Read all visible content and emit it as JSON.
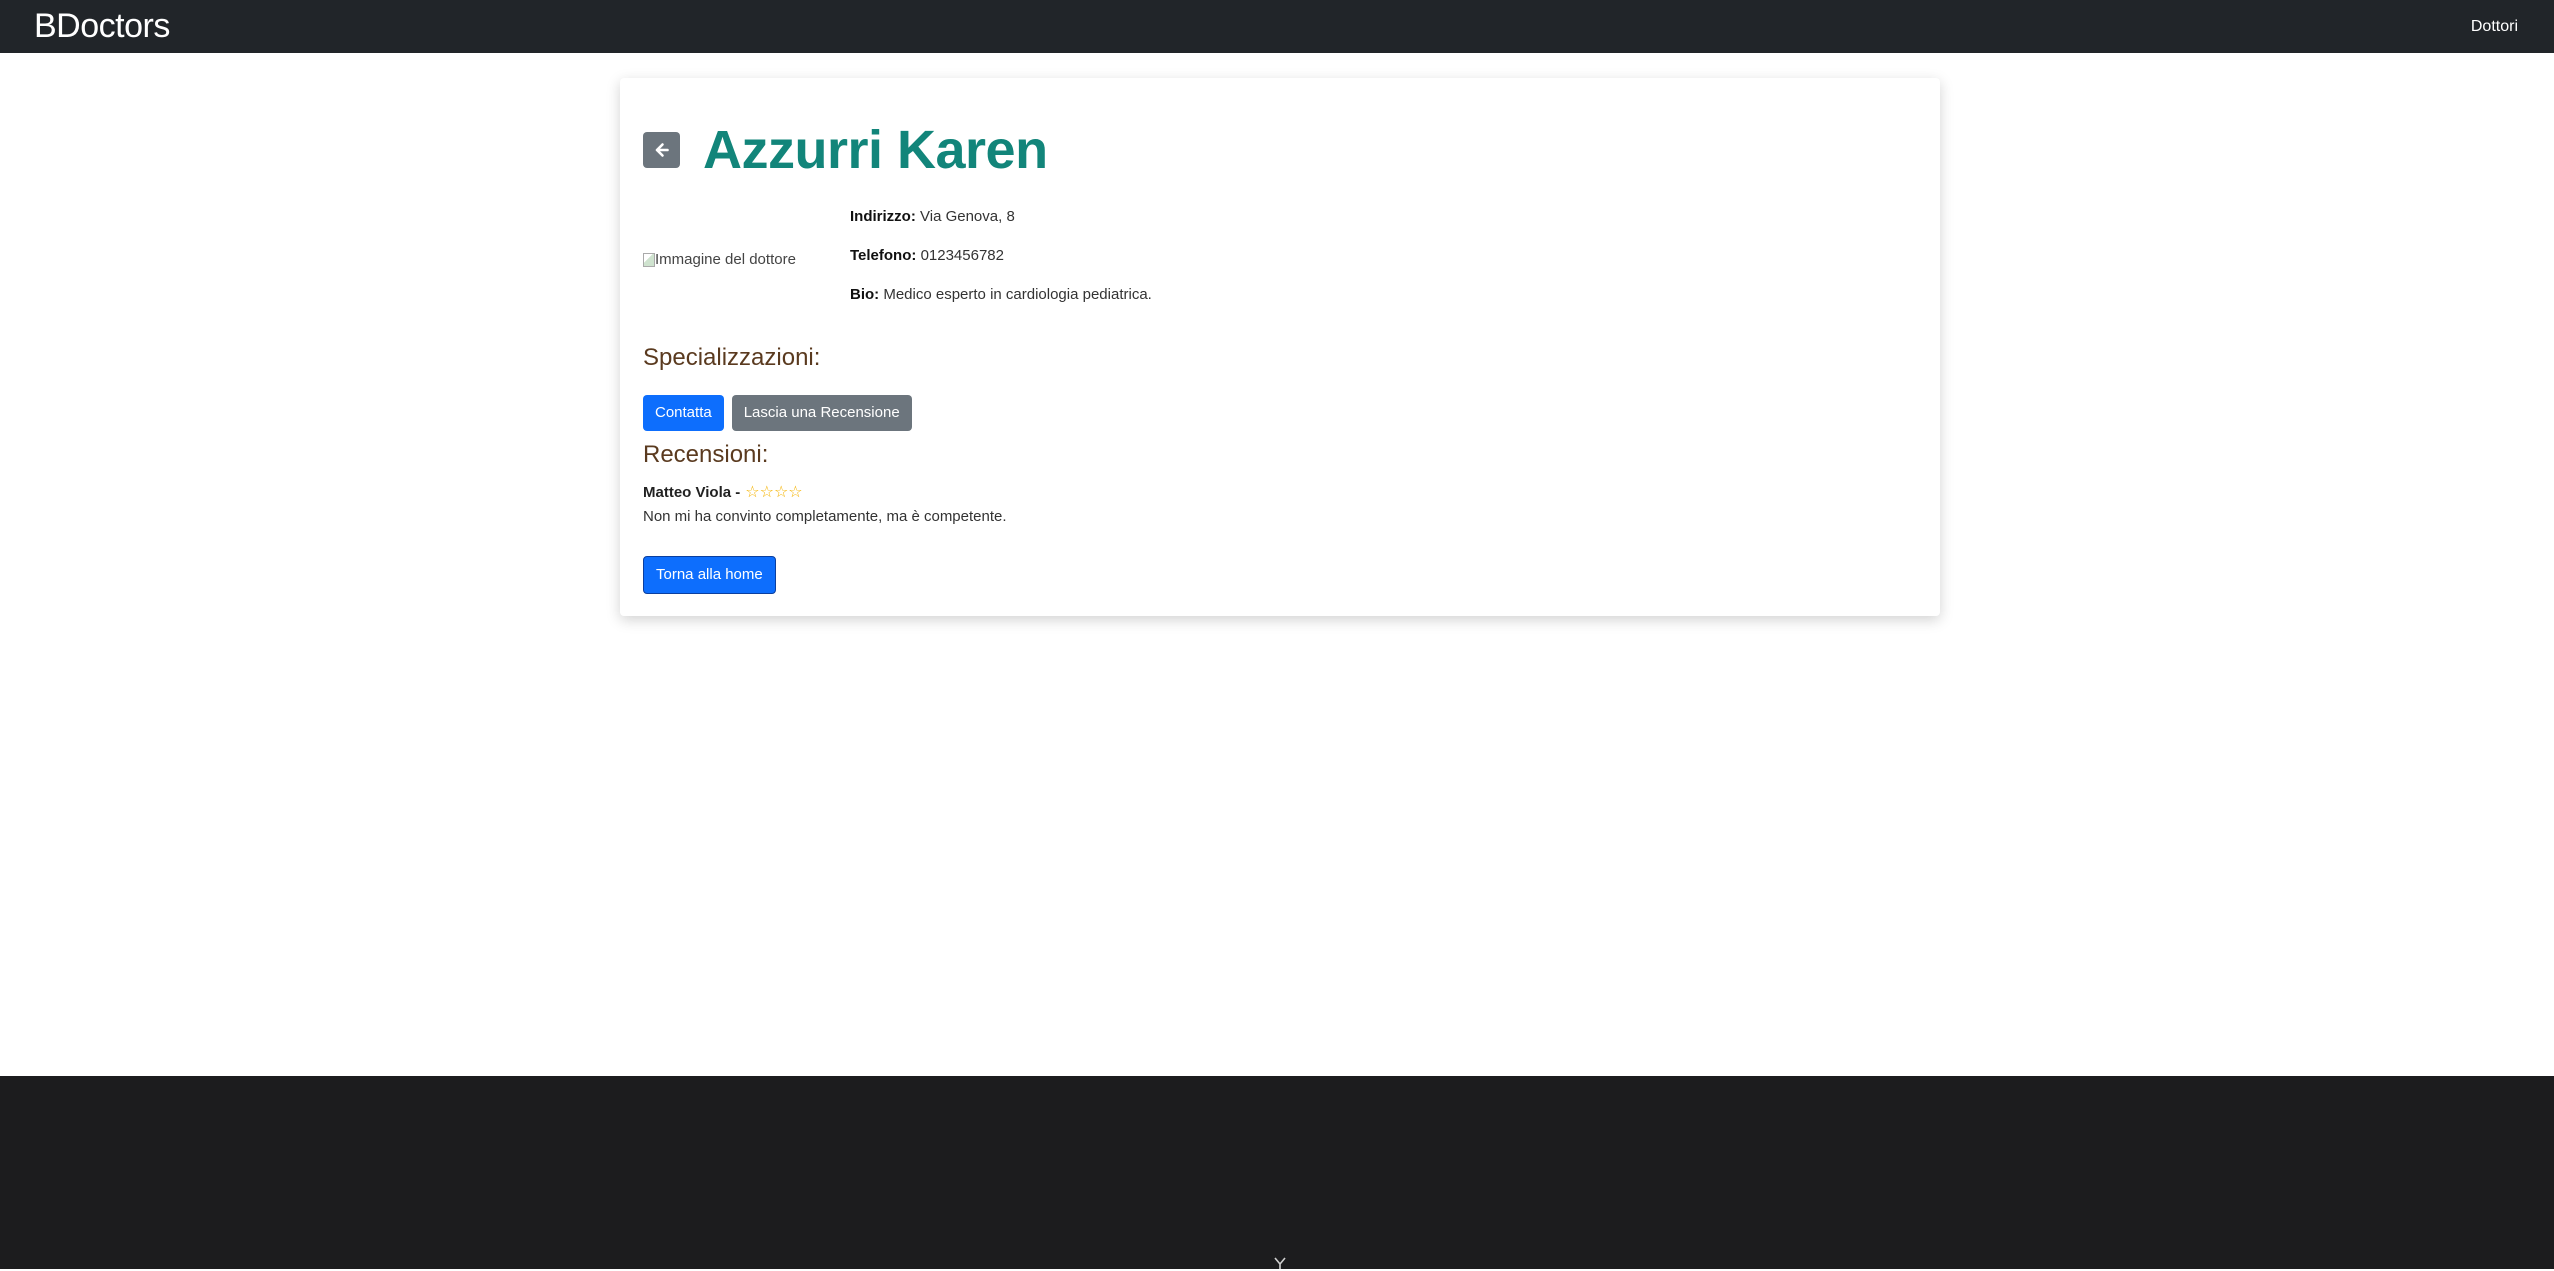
{
  "navbar": {
    "brand": "BDoctors",
    "links": [
      "Dottori"
    ]
  },
  "doctor": {
    "name": "Azzurri Karen",
    "image_alt": "Immagine del dottore",
    "fields": [
      {
        "label": "Indirizzo:",
        "value": "Via Genova, 8"
      },
      {
        "label": "Telefono:",
        "value": "0123456782"
      },
      {
        "label": "Bio:",
        "value": "Medico esperto in cardiologia pediatrica."
      }
    ]
  },
  "sections": {
    "specializations_title": "Specializzazioni:",
    "reviews_title": "Recensioni:"
  },
  "buttons": {
    "contact": "Contatta",
    "leave_review": "Lascia una Recensione",
    "home": "Torna alla home"
  },
  "reviews": [
    {
      "author": "Matteo Viola",
      "separator": "-",
      "rating": 0,
      "max_rating": 4,
      "text": "Non mi ha convinto completamente, ma è competente."
    }
  ],
  "colors": {
    "navbar_bg": "#212529",
    "title": "#12857a",
    "section_title": "#5a3a1f",
    "primary": "#0d6efd",
    "secondary": "#6c757d",
    "stars": "#f5b301",
    "footer_bg": "#1c1c1e"
  },
  "icons": {
    "back": "arrow-left-icon",
    "footer": "chevron-icon"
  }
}
